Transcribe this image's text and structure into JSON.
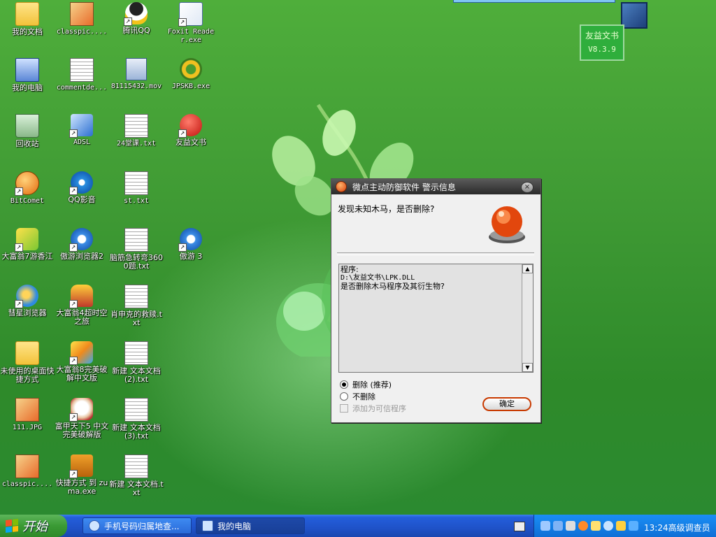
{
  "desktop_icons": [
    {
      "label": "我的文档",
      "icon": "my-documents-icon"
    },
    {
      "label": "classpic....",
      "icon": "image-file-icon"
    },
    {
      "label": "腾讯QQ",
      "icon": "qq-icon"
    },
    {
      "label": "Foxit Reader.exe",
      "icon": "foxit-reader-icon"
    },
    {
      "label": "我的电脑",
      "icon": "my-computer-icon"
    },
    {
      "label": "commentde...",
      "icon": "text-file-icon"
    },
    {
      "label": "81115432.mov",
      "icon": "mov-file-icon"
    },
    {
      "label": "JPSKB.exe",
      "icon": "jpskb-icon"
    },
    {
      "label": "回收站",
      "icon": "recycle-bin-icon"
    },
    {
      "label": "ADSL",
      "icon": "adsl-icon"
    },
    {
      "label": "24堂课.txt",
      "icon": "text-file-icon"
    },
    {
      "label": "友益文书",
      "icon": "youyi-wenshu-icon"
    },
    {
      "label": "BitComet",
      "icon": "bitcomet-icon"
    },
    {
      "label": "QQ影音",
      "icon": "qq-player-icon"
    },
    {
      "label": "st.txt",
      "icon": "text-file-icon"
    },
    {
      "label": "大富翁7游香江",
      "icon": "richman7-icon"
    },
    {
      "label": "傲游浏览器2",
      "icon": "maxthon2-icon"
    },
    {
      "label": "脑筋急转弯3600题.txt",
      "icon": "text-file-icon"
    },
    {
      "label": "傲游 3",
      "icon": "maxthon3-icon"
    },
    {
      "label": "彗星浏览器",
      "icon": "comet-browser-icon"
    },
    {
      "label": "大富翁4超时空之旅",
      "icon": "richman4-icon"
    },
    {
      "label": "肖申克的救赎.txt",
      "icon": "text-file-icon"
    },
    {
      "label": "未使用的桌面快捷方式",
      "icon": "folder-icon"
    },
    {
      "label": "大富翁8完美破解中文版",
      "icon": "richman8-icon"
    },
    {
      "label": "新建 文本文档 (2).txt",
      "icon": "text-file-icon"
    },
    {
      "label": "111.JPG",
      "icon": "image-file-icon"
    },
    {
      "label": "富甲天下5 中文完美破解版",
      "icon": "fujia5-icon"
    },
    {
      "label": "新建 文本文档 (3).txt",
      "icon": "text-file-icon"
    },
    {
      "label": "classpic....",
      "icon": "image-file-icon"
    },
    {
      "label": "快捷方式 到 zuma.exe",
      "icon": "zuma-icon"
    },
    {
      "label": "新建 文本文档.txt",
      "icon": "text-file-icon"
    }
  ],
  "app_badge": {
    "name": "友益文书",
    "version": "V8.3.9"
  },
  "dialog": {
    "title": "微点主动防御软件  警示信息",
    "question": "发现未知木马，是否删除?",
    "info_label": "程序:",
    "info_path": "D:\\友益文书\\LPK.DLL",
    "info_question": "是否删除木马程序及其衍生物?",
    "option_delete": "删除 (推荐)",
    "option_keep": "不删除",
    "option_trust": "添加为可信程序",
    "ok_label": "确定",
    "close_glyph": "×",
    "scroll_up": "▲",
    "scroll_down": "▼"
  },
  "taskbar": {
    "start_label": "开始",
    "tasks": [
      {
        "label": "手机号码归属地查...",
        "active": true
      },
      {
        "label": "我的电脑",
        "active": false
      }
    ],
    "clock": "13:24",
    "user": "高级调查员"
  },
  "colors": {
    "desktop_green": "#3a8d3a",
    "taskbar_blue": "#245edb",
    "start_green": "#3a9a34",
    "dialog_title": "#2a2a2a",
    "alarm_red": "#e2470d"
  }
}
